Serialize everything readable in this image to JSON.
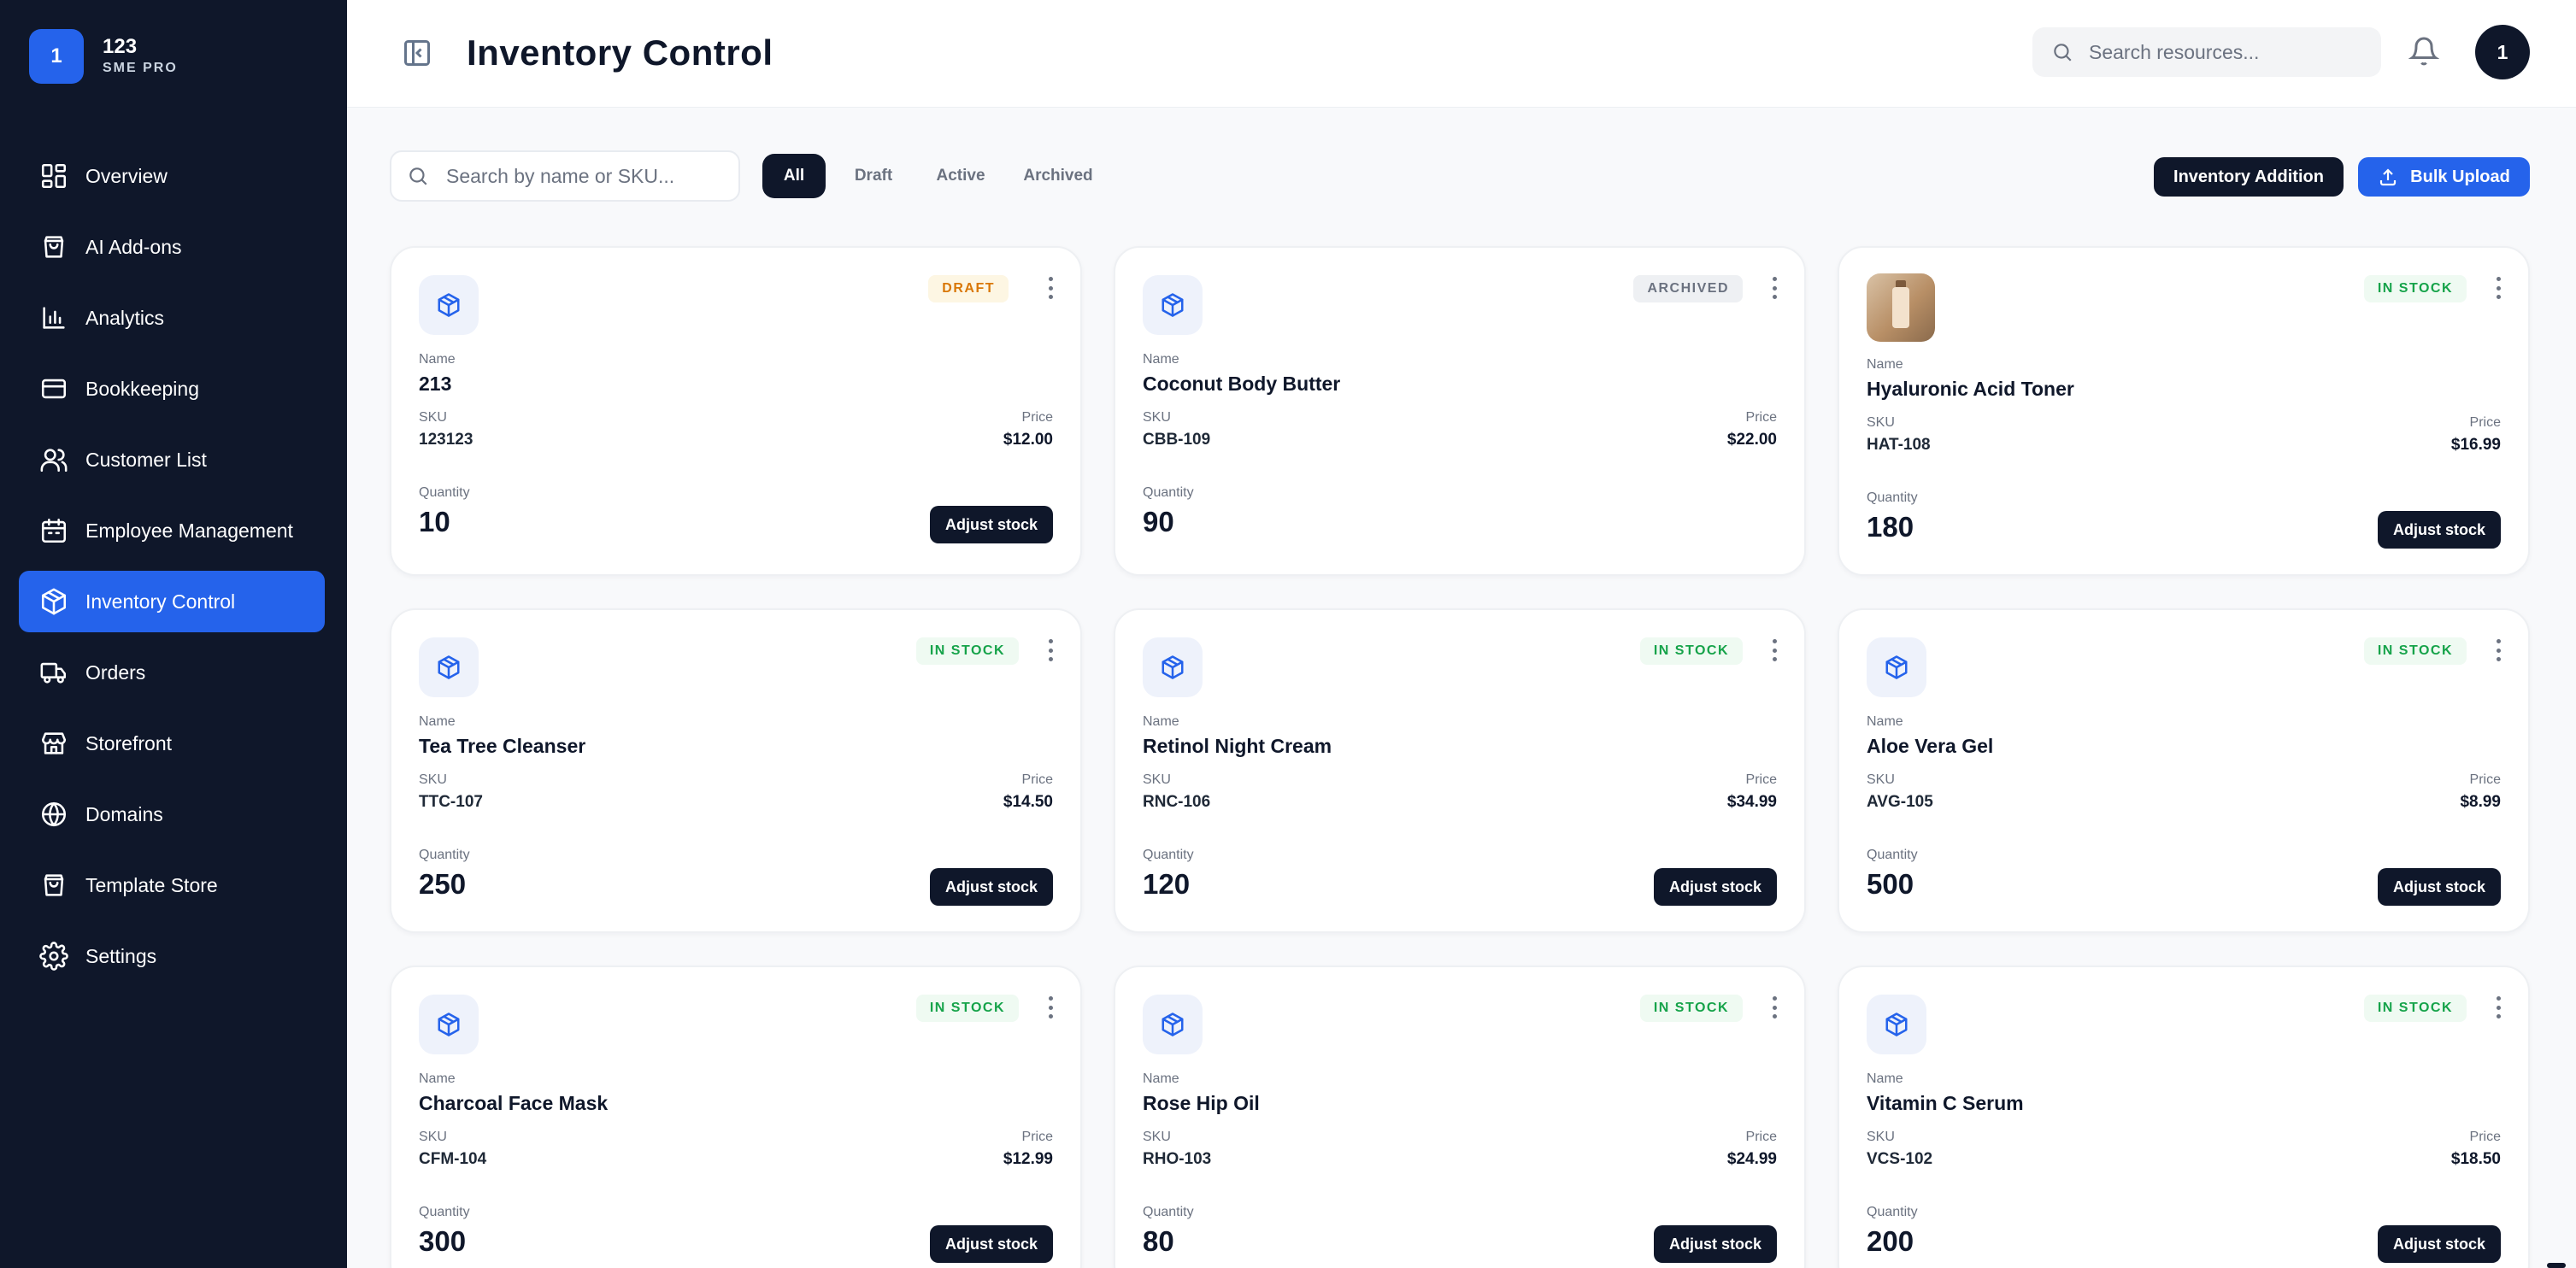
{
  "brand": {
    "logo_text": "1",
    "name": "123",
    "subtitle": "SME PRO"
  },
  "sidebar": {
    "items": [
      {
        "label": "Overview",
        "icon": "grid-icon"
      },
      {
        "label": "AI Add-ons",
        "icon": "bag-icon"
      },
      {
        "label": "Analytics",
        "icon": "bar-chart-icon"
      },
      {
        "label": "Bookkeeping",
        "icon": "credit-card-icon"
      },
      {
        "label": "Customer List",
        "icon": "users-icon"
      },
      {
        "label": "Employee Management",
        "icon": "calendar-icon"
      },
      {
        "label": "Inventory Control",
        "icon": "box-icon",
        "active": true
      },
      {
        "label": "Orders",
        "icon": "truck-icon"
      },
      {
        "label": "Storefront",
        "icon": "store-icon"
      },
      {
        "label": "Domains",
        "icon": "globe-icon"
      },
      {
        "label": "Template Store",
        "icon": "bag-icon"
      },
      {
        "label": "Settings",
        "icon": "gear-icon"
      }
    ]
  },
  "header": {
    "title": "Inventory Control",
    "search_placeholder": "Search resources...",
    "avatar_text": "1"
  },
  "toolbar": {
    "search_placeholder": "Search by name or SKU...",
    "filters": [
      "All",
      "Draft",
      "Active",
      "Archived"
    ],
    "active_filter": "All",
    "inventory_addition_label": "Inventory Addition",
    "bulk_upload_label": "Bulk Upload"
  },
  "labels": {
    "name": "Name",
    "sku": "SKU",
    "price": "Price",
    "quantity": "Quantity",
    "adjust": "Adjust stock"
  },
  "products": [
    {
      "name": "213",
      "sku": "123123",
      "price": "$12.00",
      "quantity": "10",
      "status": "DRAFT",
      "status_type": "draft",
      "has_adjust": true,
      "has_image": false
    },
    {
      "name": "Coconut Body Butter",
      "sku": "CBB-109",
      "price": "$22.00",
      "quantity": "90",
      "status": "ARCHIVED",
      "status_type": "archived",
      "has_adjust": false,
      "has_image": false
    },
    {
      "name": "Hyaluronic Acid Toner",
      "sku": "HAT-108",
      "price": "$16.99",
      "quantity": "180",
      "status": "IN STOCK",
      "status_type": "instock",
      "has_adjust": true,
      "has_image": true
    },
    {
      "name": "Tea Tree Cleanser",
      "sku": "TTC-107",
      "price": "$14.50",
      "quantity": "250",
      "status": "IN STOCK",
      "status_type": "instock",
      "has_adjust": true,
      "has_image": false
    },
    {
      "name": "Retinol Night Cream",
      "sku": "RNC-106",
      "price": "$34.99",
      "quantity": "120",
      "status": "IN STOCK",
      "status_type": "instock",
      "has_adjust": true,
      "has_image": false
    },
    {
      "name": "Aloe Vera Gel",
      "sku": "AVG-105",
      "price": "$8.99",
      "quantity": "500",
      "status": "IN STOCK",
      "status_type": "instock",
      "has_adjust": true,
      "has_image": false
    },
    {
      "name": "Charcoal Face Mask",
      "sku": "CFM-104",
      "price": "$12.99",
      "quantity": "300",
      "status": "IN STOCK",
      "status_type": "instock",
      "has_adjust": true,
      "has_image": false
    },
    {
      "name": "Rose Hip Oil",
      "sku": "RHO-103",
      "price": "$24.99",
      "quantity": "80",
      "status": "IN STOCK",
      "status_type": "instock",
      "has_adjust": true,
      "has_image": false
    },
    {
      "name": "Vitamin C Serum",
      "sku": "VCS-102",
      "price": "$18.50",
      "quantity": "200",
      "status": "IN STOCK",
      "status_type": "instock",
      "has_adjust": true,
      "has_image": false
    }
  ],
  "colors": {
    "sidebar_bg": "#0f172a",
    "accent": "#2563eb",
    "draft": "#d97706",
    "instock": "#16a34a",
    "archived": "#6b7280"
  }
}
